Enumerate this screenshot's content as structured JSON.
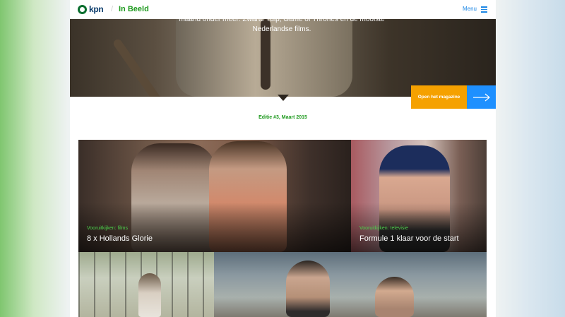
{
  "header": {
    "logo_text": "kpn",
    "separator": "/",
    "site_title": "In Beeld",
    "menu_label": "Menu"
  },
  "hero": {
    "text": "maand onder meer: Zwarte Tulp, Game of Thrones en de mooiste Nederlandse films.",
    "open_label": "Open het magazine"
  },
  "edition": "Editie #3, Maart 2015",
  "tiles": [
    {
      "category": "Vooruitkijken: films",
      "title": "8 x Hollands Glorie"
    },
    {
      "category": "Vooruitkijken: televisie",
      "title": "Formule 1 klaar voor de start"
    }
  ],
  "colors": {
    "brand_green": "#1e9a1e",
    "accent_orange": "#f5a100",
    "accent_blue": "#1e90ff",
    "menu_blue": "#1e88e5"
  },
  "icons": [
    "kpn-logo-icon",
    "hamburger-menu-icon",
    "arrow-right-icon"
  ]
}
